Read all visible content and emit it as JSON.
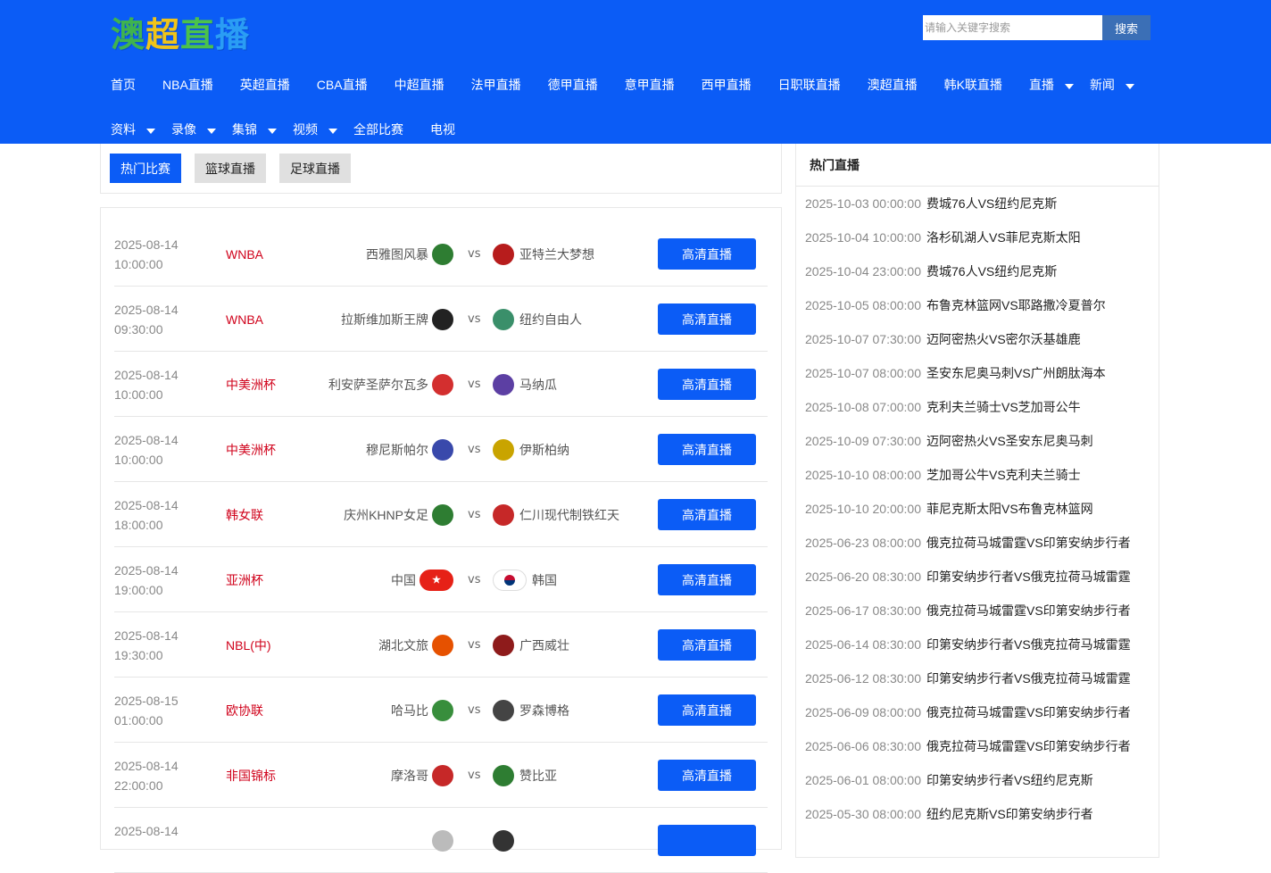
{
  "header": {
    "logo_chars": [
      "澳",
      "超",
      "直",
      "播"
    ],
    "logo_colors": [
      "#3fb34f",
      "#f0c419",
      "#4bc24b",
      "#2a9df4"
    ],
    "search": {
      "placeholder": "请输入关键字搜索",
      "button": "搜索"
    }
  },
  "nav": {
    "row1": [
      {
        "label": "首页",
        "dropdown": false
      },
      {
        "label": "NBA直播",
        "dropdown": false
      },
      {
        "label": "英超直播",
        "dropdown": false
      },
      {
        "label": "CBA直播",
        "dropdown": false
      },
      {
        "label": "中超直播",
        "dropdown": false
      },
      {
        "label": "法甲直播",
        "dropdown": false
      },
      {
        "label": "德甲直播",
        "dropdown": false
      },
      {
        "label": "意甲直播",
        "dropdown": false
      },
      {
        "label": "西甲直播",
        "dropdown": false
      },
      {
        "label": "日职联直播",
        "dropdown": false
      },
      {
        "label": "澳超直播",
        "dropdown": false
      },
      {
        "label": "韩K联直播",
        "dropdown": false
      },
      {
        "label": "直播",
        "dropdown": true
      },
      {
        "label": "新闻",
        "dropdown": true
      }
    ],
    "row2": [
      {
        "label": "资料",
        "dropdown": true
      },
      {
        "label": "录像",
        "dropdown": true
      },
      {
        "label": "集锦",
        "dropdown": true
      },
      {
        "label": "视频",
        "dropdown": true
      },
      {
        "label": "全部比赛",
        "dropdown": false
      },
      {
        "label": "电视",
        "dropdown": false
      }
    ]
  },
  "tabs": [
    {
      "label": "热门比赛",
      "active": true
    },
    {
      "label": "篮球直播",
      "active": false
    },
    {
      "label": "足球直播",
      "active": false
    }
  ],
  "matches": [
    {
      "date": "2025-08-14",
      "time": "10:00:00",
      "league": "WNBA",
      "home": "西雅图风暴",
      "away": "亚特兰大梦想",
      "vs": "vs",
      "button": "高清直播",
      "home_color": "#2e7d32",
      "away_color": "#b71c1c"
    },
    {
      "date": "2025-08-14",
      "time": "09:30:00",
      "league": "WNBA",
      "home": "拉斯维加斯王牌",
      "away": "纽约自由人",
      "vs": "vs",
      "button": "高清直播",
      "home_color": "#222222",
      "away_color": "#3a8f6a"
    },
    {
      "date": "2025-08-14",
      "time": "10:00:00",
      "league": "中美洲杯",
      "home": "利安萨圣萨尔瓦多",
      "away": "马纳瓜",
      "vs": "vs",
      "button": "高清直播",
      "home_color": "#d32f2f",
      "away_color": "#5c3fa3"
    },
    {
      "date": "2025-08-14",
      "time": "10:00:00",
      "league": "中美洲杯",
      "home": "穆尼斯帕尔",
      "away": "伊斯柏纳",
      "vs": "vs",
      "button": "高清直播",
      "home_color": "#3949ab",
      "away_color": "#c9a400"
    },
    {
      "date": "2025-08-14",
      "time": "18:00:00",
      "league": "韩女联",
      "home": "庆州KHNP女足",
      "away": "仁川现代制铁红天",
      "vs": "vs",
      "button": "高清直播",
      "home_color": "#2e7d32",
      "away_color": "#c62828"
    },
    {
      "date": "2025-08-14",
      "time": "19:00:00",
      "league": "亚洲杯",
      "home": "中国",
      "away": "韩国",
      "vs": "vs",
      "button": "高清直播",
      "home_color": "#e62117",
      "away_color": "#1e4fa8"
    },
    {
      "date": "2025-08-14",
      "time": "19:30:00",
      "league": "NBL(中)",
      "home": "湖北文旅",
      "away": "广西威壮",
      "vs": "vs",
      "button": "高清直播",
      "home_color": "#e65100",
      "away_color": "#8e1b1b"
    },
    {
      "date": "2025-08-15",
      "time": "01:00:00",
      "league": "欧协联",
      "home": "哈马比",
      "away": "罗森博格",
      "vs": "vs",
      "button": "高清直播",
      "home_color": "#388e3c",
      "away_color": "#444444"
    },
    {
      "date": "2025-08-14",
      "time": "22:00:00",
      "league": "非国锦标",
      "home": "摩洛哥",
      "away": "赞比亚",
      "vs": "vs",
      "button": "高清直播",
      "home_color": "#c62828",
      "away_color": "#2e7d32"
    },
    {
      "date": "2025-08-14",
      "time": "",
      "league": "",
      "home": "",
      "away": "",
      "vs": "",
      "button": "",
      "home_color": "#bbbbbb",
      "away_color": "#333333"
    }
  ],
  "hot": {
    "title": "热门直播",
    "items": [
      {
        "time": "2025-10-03 00:00:00",
        "name": "费城76人VS纽约尼克斯"
      },
      {
        "time": "2025-10-04 10:00:00",
        "name": "洛杉矶湖人VS菲尼克斯太阳"
      },
      {
        "time": "2025-10-04 23:00:00",
        "name": "费城76人VS纽约尼克斯"
      },
      {
        "time": "2025-10-05 08:00:00",
        "name": "布鲁克林篮网VS耶路撒冷夏普尔"
      },
      {
        "time": "2025-10-07 07:30:00",
        "name": "迈阿密热火VS密尔沃基雄鹿"
      },
      {
        "time": "2025-10-07 08:00:00",
        "name": "圣安东尼奥马刺VS广州朗肽海本"
      },
      {
        "time": "2025-10-08 07:00:00",
        "name": "克利夫兰骑士VS芝加哥公牛"
      },
      {
        "time": "2025-10-09 07:30:00",
        "name": "迈阿密热火VS圣安东尼奥马刺"
      },
      {
        "time": "2025-10-10 08:00:00",
        "name": "芝加哥公牛VS克利夫兰骑士"
      },
      {
        "time": "2025-10-10 20:00:00",
        "name": "菲尼克斯太阳VS布鲁克林篮网"
      },
      {
        "time": "2025-06-23 08:00:00",
        "name": "俄克拉荷马城雷霆VS印第安纳步行者"
      },
      {
        "time": "2025-06-20 08:30:00",
        "name": "印第安纳步行者VS俄克拉荷马城雷霆"
      },
      {
        "time": "2025-06-17 08:30:00",
        "name": "俄克拉荷马城雷霆VS印第安纳步行者"
      },
      {
        "time": "2025-06-14 08:30:00",
        "name": "印第安纳步行者VS俄克拉荷马城雷霆"
      },
      {
        "time": "2025-06-12 08:30:00",
        "name": "印第安纳步行者VS俄克拉荷马城雷霆"
      },
      {
        "time": "2025-06-09 08:00:00",
        "name": "俄克拉荷马城雷霆VS印第安纳步行者"
      },
      {
        "time": "2025-06-06 08:30:00",
        "name": "俄克拉荷马城雷霆VS印第安纳步行者"
      },
      {
        "time": "2025-06-01 08:00:00",
        "name": "印第安纳步行者VS纽约尼克斯"
      },
      {
        "time": "2025-05-30 08:00:00",
        "name": "纽约尼克斯VS印第安纳步行者"
      }
    ]
  }
}
